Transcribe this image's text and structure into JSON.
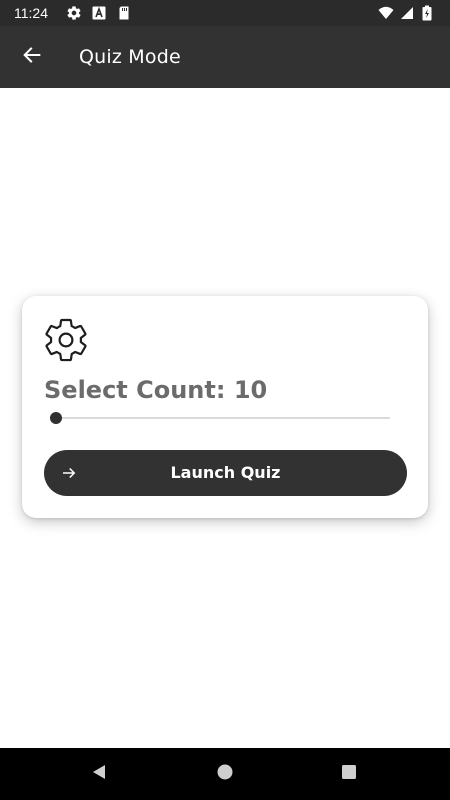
{
  "status_bar": {
    "time": "11:24",
    "left_icons": [
      "gear-icon",
      "font-a-icon",
      "sd-card-icon"
    ],
    "right_icons": [
      "wifi-icon",
      "signal-icon",
      "battery-charging-icon"
    ]
  },
  "app_bar": {
    "title": "Quiz Mode",
    "back_icon": "arrow-left-icon"
  },
  "card": {
    "icon": "gear-icon",
    "count_label": "Select Count: 10",
    "slider": {
      "value": 10,
      "fraction": 0.0
    },
    "launch_button": {
      "label": "Launch Quiz",
      "icon": "arrow-right-icon"
    }
  },
  "nav_bar": {
    "items": [
      "back-triangle-icon",
      "home-circle-icon",
      "recents-square-icon"
    ]
  },
  "colors": {
    "app_bar": "#323232",
    "status_bar": "#2b2b2b",
    "button": "#323232",
    "label_gray": "#6b6b6b"
  }
}
